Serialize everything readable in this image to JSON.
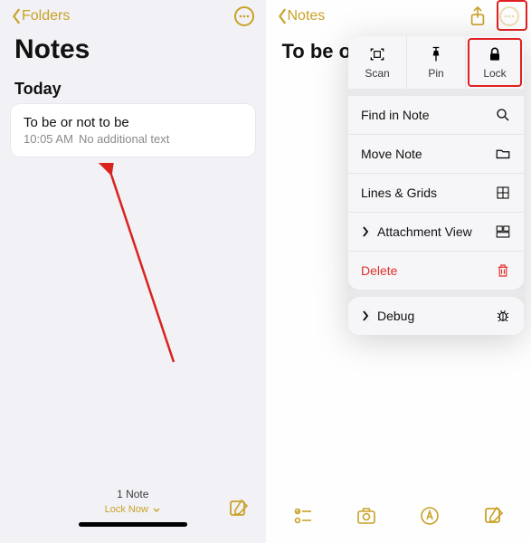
{
  "left": {
    "back_label": "Folders",
    "heading": "Notes",
    "section": "Today",
    "note": {
      "title": "To be or not to be",
      "time": "10:05 AM",
      "preview": "No additional text"
    },
    "footer": {
      "count": "1 Note",
      "lock_now": "Lock Now"
    }
  },
  "right": {
    "back_label": "Notes",
    "note_title": "To be or",
    "tools": {
      "scan": "Scan",
      "pin": "Pin",
      "lock": "Lock"
    },
    "menu": {
      "find": "Find in Note",
      "move": "Move Note",
      "lines": "Lines & Grids",
      "attach": "Attachment View",
      "delete": "Delete",
      "debug": "Debug"
    }
  },
  "colors": {
    "accent": "#c9a227",
    "destructive": "#e0302b",
    "highlight": "#e02020"
  }
}
